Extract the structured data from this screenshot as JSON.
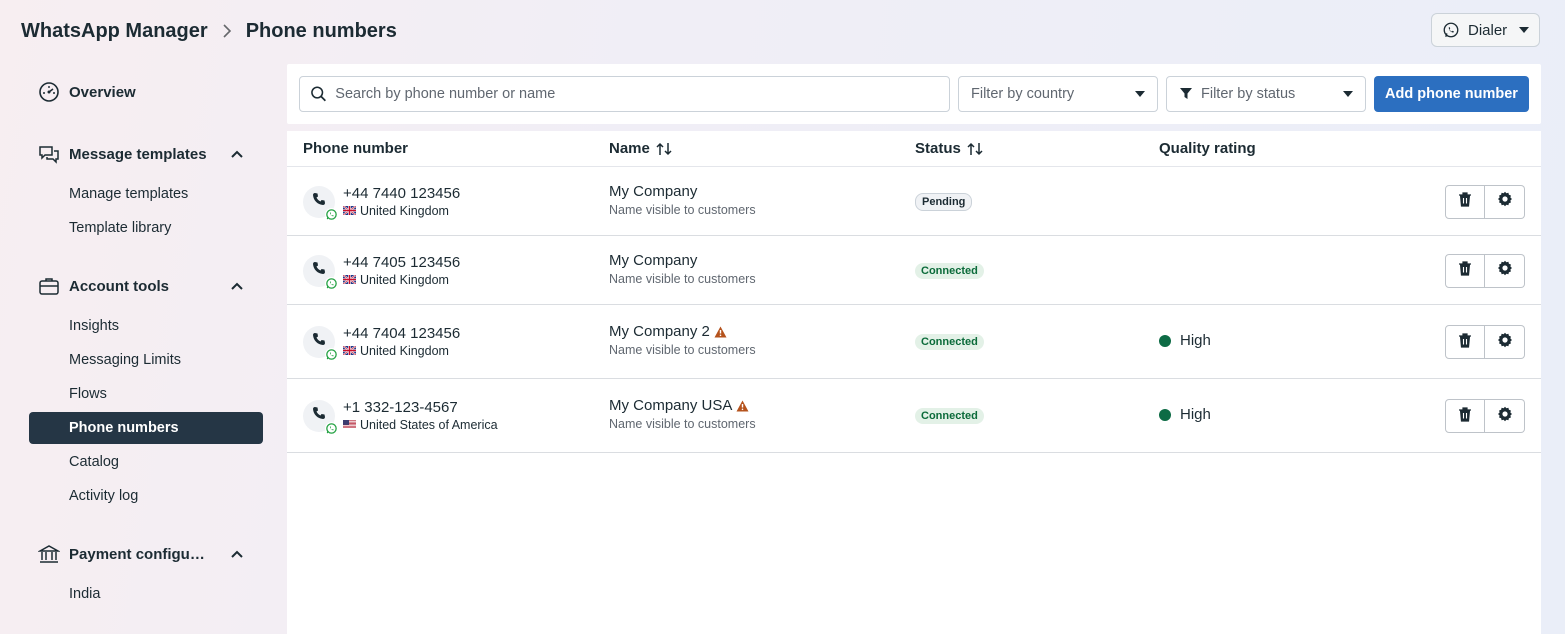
{
  "header": {
    "breadcrumb_root": "WhatsApp Manager",
    "breadcrumb_current": "Phone numbers",
    "dialer_label": "Dialer"
  },
  "sidebar": {
    "overview": "Overview",
    "message_templates": {
      "label": "Message templates",
      "items": [
        "Manage templates",
        "Template library"
      ]
    },
    "account_tools": {
      "label": "Account tools",
      "items": [
        "Insights",
        "Messaging Limits",
        "Flows",
        "Phone numbers",
        "Catalog",
        "Activity log"
      ],
      "active": "Phone numbers"
    },
    "payment_config": {
      "label": "Payment configu…",
      "items": [
        "India"
      ]
    }
  },
  "toolbar": {
    "search_placeholder": "Search by phone number or name",
    "filter_country": "Filter by country",
    "filter_status": "Filter by status",
    "add_button": "Add phone number"
  },
  "table": {
    "columns": {
      "phone": "Phone number",
      "name": "Name",
      "status": "Status",
      "quality": "Quality rating"
    },
    "rows": [
      {
        "phone": "+44 7440 123456",
        "country": "United Kingdom",
        "flag": "uk",
        "name": "My Company",
        "name_warning": false,
        "name_sub": "Name visible to customers",
        "status": "Pending",
        "status_type": "pending",
        "quality": ""
      },
      {
        "phone": "+44 7405 123456",
        "country": "United Kingdom",
        "flag": "uk",
        "name": "My Company",
        "name_warning": false,
        "name_sub": "Name visible to customers",
        "status": "Connected",
        "status_type": "connected",
        "quality": ""
      },
      {
        "phone": "+44 7404 123456",
        "country": "United Kingdom",
        "flag": "uk",
        "name": "My Company 2",
        "name_warning": true,
        "name_sub": "Name visible to customers",
        "status": "Connected",
        "status_type": "connected",
        "quality": "High"
      },
      {
        "phone": "+1 332-123-4567",
        "country": "United States of America",
        "flag": "us",
        "name": "My Company USA",
        "name_warning": true,
        "name_sub": "Name visible to customers",
        "status": "Connected",
        "status_type": "connected",
        "quality": "High"
      }
    ]
  },
  "colors": {
    "active_nav_bg": "#253645",
    "primary_button": "#2c6fc0",
    "connected_bg": "#e3f1e7",
    "connected_text": "#0b6b3a",
    "quality_high": "#0d6b45",
    "warning": "#b5531d"
  },
  "icons": {
    "overview": "dashboard-icon",
    "message_templates": "chat-bubbles-icon",
    "account_tools": "briefcase-icon",
    "payment_config": "bank-icon",
    "delete": "trash-icon",
    "settings": "gear-icon"
  }
}
